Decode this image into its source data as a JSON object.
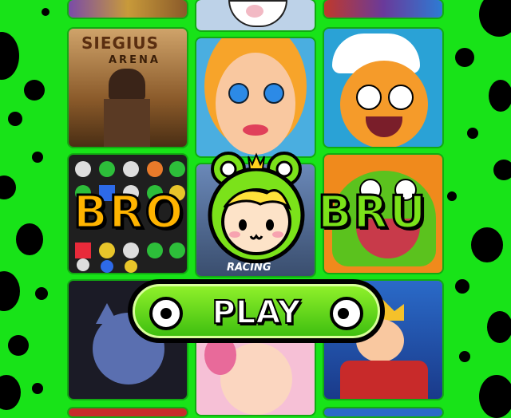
{
  "game": {
    "logo_left": "BRO",
    "logo_right": "BRU",
    "play_label": "PLAY"
  },
  "tiles": {
    "siegius_title": "SIEGIUS",
    "siegius_sub": "ARENA",
    "racing_label": "RACING"
  },
  "colors": {
    "background": "#18e318",
    "logo_orange": "#ffb400",
    "logo_green": "#7be21a",
    "button_green": "#5ad01c"
  }
}
